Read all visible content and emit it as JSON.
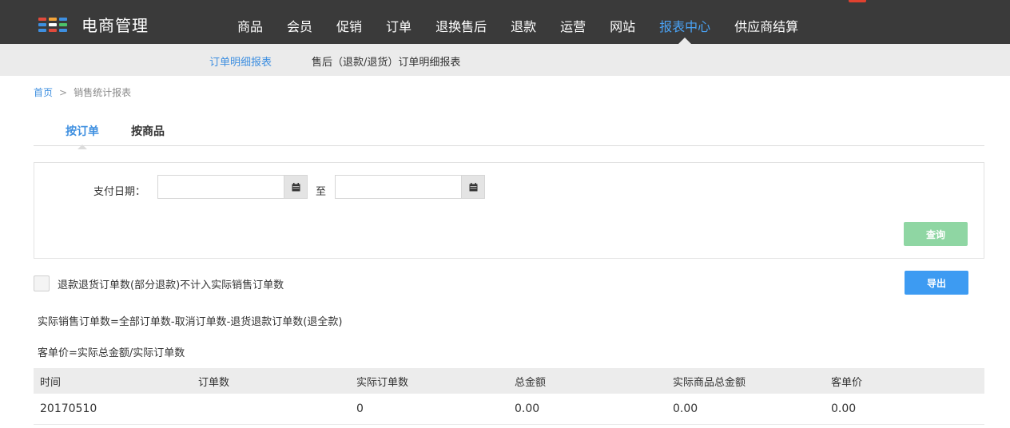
{
  "app": {
    "title": "电商管理",
    "logo_colors": [
      "#e04a3c",
      "#f2a43a",
      "#3e8fe0",
      "#3e8fe0",
      "#ffffff",
      "#4cc36a",
      "#3e8fe0",
      "#e04a3c",
      "#3e8fe0"
    ]
  },
  "top_nav": {
    "items": [
      "商品",
      "会员",
      "促销",
      "订单",
      "退换售后",
      "退款",
      "运营",
      "网站",
      "报表中心",
      "供应商结算"
    ],
    "active": "报表中心"
  },
  "sub_nav": {
    "items": [
      "订单明细报表",
      "售后（退款/退货）订单明细报表"
    ],
    "active": "订单明细报表"
  },
  "breadcrumb": {
    "home": "首页",
    "separator": ">",
    "current": "销售统计报表"
  },
  "tabs": {
    "items": [
      "按订单",
      "按商品"
    ],
    "active": "按订单"
  },
  "filter": {
    "label": "支付日期：",
    "start_value": "",
    "to_label": "至",
    "end_value": "",
    "query_button": "查询"
  },
  "options": {
    "checkbox_label": "退款退货订单数(部分退款)不计入实际销售订单数",
    "checked": false,
    "export_button": "导出"
  },
  "notes": {
    "formula1": "实际销售订单数=全部订单数-取消订单数-退货退款订单数(退全款)",
    "formula2": "客单价=实际总金额/实际订单数"
  },
  "table": {
    "columns": [
      "时间",
      "订单数",
      "实际订单数",
      "总金额",
      "实际商品总金额",
      "客单价"
    ],
    "rows": [
      [
        "20170510",
        "",
        "0",
        "0.00",
        "0.00",
        "0.00"
      ]
    ]
  },
  "colors": {
    "topbar": "#3a3a3a",
    "accent": "#3e8fe0",
    "query_button": "#8fd6a3",
    "export_button": "#3d9bf2"
  }
}
